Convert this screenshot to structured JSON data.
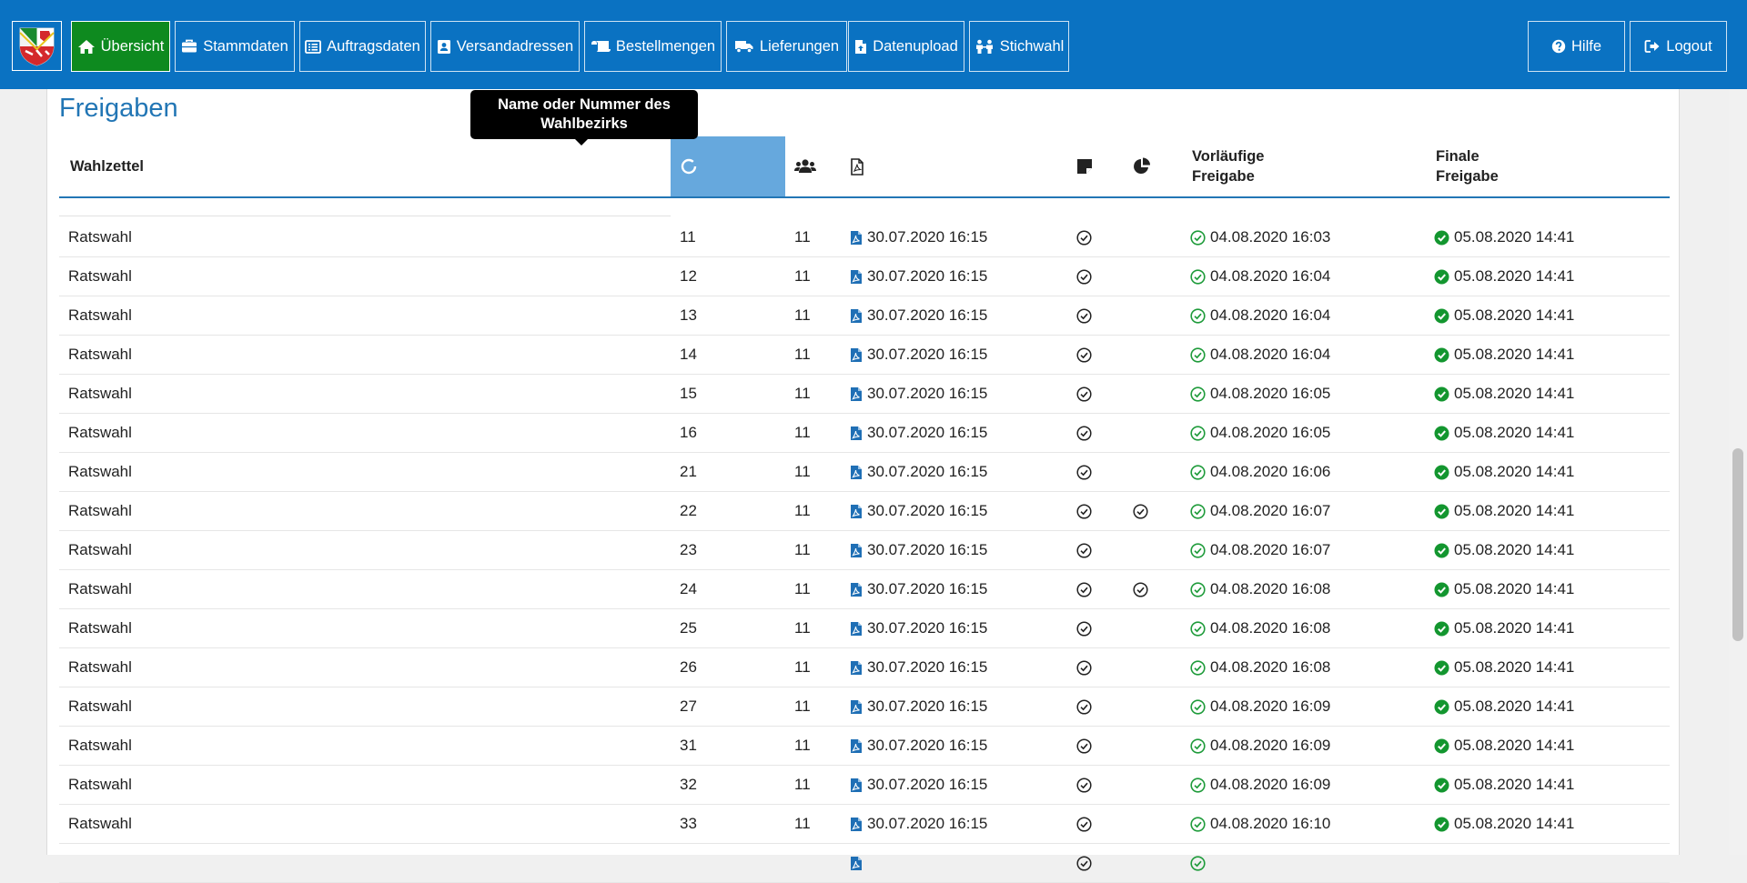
{
  "nav": {
    "items": [
      {
        "label": "Übersicht",
        "icon": "home-icon",
        "active": true
      },
      {
        "label": "Stammdaten",
        "icon": "briefcase-icon",
        "active": false
      },
      {
        "label": "Auftragsdaten",
        "icon": "list-icon",
        "active": false
      },
      {
        "label": "Versandadressen",
        "icon": "address-card-icon",
        "active": false
      },
      {
        "label": "Bestellmengen",
        "icon": "scroll-icon",
        "active": false
      },
      {
        "label": "Lieferungen",
        "icon": "truck-icon",
        "active": false
      },
      {
        "label": "Datenupload",
        "icon": "file-upload-icon",
        "active": false
      },
      {
        "label": "Stichwahl",
        "icon": "people-icon",
        "active": false
      }
    ],
    "right": [
      {
        "label": "Hilfe",
        "icon": "question-circle-icon"
      },
      {
        "label": "Logout",
        "icon": "sign-out-icon"
      }
    ]
  },
  "page": {
    "title": "Freigaben",
    "tooltip": "Name oder Nummer des Wahlbezirks"
  },
  "table": {
    "headers": {
      "wahlzettel": "Wahlzettel",
      "vorlaeufig_line1": "Vorläufige",
      "vorlaeufig_line2": "Freigabe",
      "final_line1": "Finale",
      "final_line2": "Freigabe"
    },
    "header_icons": [
      "circle-sort-icon",
      "users-icon",
      "file-pdf-icon",
      "sticky-note-icon",
      "pie-chart-icon"
    ],
    "rows": [
      {
        "wahlzettel": "Ratswahl",
        "nr": "11",
        "wz": "11",
        "pdf": "30.07.2020 16:15",
        "note": true,
        "chart": false,
        "vorlaeufig": "04.08.2020 16:03",
        "final": "05.08.2020 14:41"
      },
      {
        "wahlzettel": "Ratswahl",
        "nr": "12",
        "wz": "11",
        "pdf": "30.07.2020 16:15",
        "note": true,
        "chart": false,
        "vorlaeufig": "04.08.2020 16:04",
        "final": "05.08.2020 14:41"
      },
      {
        "wahlzettel": "Ratswahl",
        "nr": "13",
        "wz": "11",
        "pdf": "30.07.2020 16:15",
        "note": true,
        "chart": false,
        "vorlaeufig": "04.08.2020 16:04",
        "final": "05.08.2020 14:41"
      },
      {
        "wahlzettel": "Ratswahl",
        "nr": "14",
        "wz": "11",
        "pdf": "30.07.2020 16:15",
        "note": true,
        "chart": false,
        "vorlaeufig": "04.08.2020 16:04",
        "final": "05.08.2020 14:41"
      },
      {
        "wahlzettel": "Ratswahl",
        "nr": "15",
        "wz": "11",
        "pdf": "30.07.2020 16:15",
        "note": true,
        "chart": false,
        "vorlaeufig": "04.08.2020 16:05",
        "final": "05.08.2020 14:41"
      },
      {
        "wahlzettel": "Ratswahl",
        "nr": "16",
        "wz": "11",
        "pdf": "30.07.2020 16:15",
        "note": true,
        "chart": false,
        "vorlaeufig": "04.08.2020 16:05",
        "final": "05.08.2020 14:41"
      },
      {
        "wahlzettel": "Ratswahl",
        "nr": "21",
        "wz": "11",
        "pdf": "30.07.2020 16:15",
        "note": true,
        "chart": false,
        "vorlaeufig": "04.08.2020 16:06",
        "final": "05.08.2020 14:41"
      },
      {
        "wahlzettel": "Ratswahl",
        "nr": "22",
        "wz": "11",
        "pdf": "30.07.2020 16:15",
        "note": true,
        "chart": true,
        "vorlaeufig": "04.08.2020 16:07",
        "final": "05.08.2020 14:41"
      },
      {
        "wahlzettel": "Ratswahl",
        "nr": "23",
        "wz": "11",
        "pdf": "30.07.2020 16:15",
        "note": true,
        "chart": false,
        "vorlaeufig": "04.08.2020 16:07",
        "final": "05.08.2020 14:41"
      },
      {
        "wahlzettel": "Ratswahl",
        "nr": "24",
        "wz": "11",
        "pdf": "30.07.2020 16:15",
        "note": true,
        "chart": true,
        "vorlaeufig": "04.08.2020 16:08",
        "final": "05.08.2020 14:41"
      },
      {
        "wahlzettel": "Ratswahl",
        "nr": "25",
        "wz": "11",
        "pdf": "30.07.2020 16:15",
        "note": true,
        "chart": false,
        "vorlaeufig": "04.08.2020 16:08",
        "final": "05.08.2020 14:41"
      },
      {
        "wahlzettel": "Ratswahl",
        "nr": "26",
        "wz": "11",
        "pdf": "30.07.2020 16:15",
        "note": true,
        "chart": false,
        "vorlaeufig": "04.08.2020 16:08",
        "final": "05.08.2020 14:41"
      },
      {
        "wahlzettel": "Ratswahl",
        "nr": "27",
        "wz": "11",
        "pdf": "30.07.2020 16:15",
        "note": true,
        "chart": false,
        "vorlaeufig": "04.08.2020 16:09",
        "final": "05.08.2020 14:41"
      },
      {
        "wahlzettel": "Ratswahl",
        "nr": "31",
        "wz": "11",
        "pdf": "30.07.2020 16:15",
        "note": true,
        "chart": false,
        "vorlaeufig": "04.08.2020 16:09",
        "final": "05.08.2020 14:41"
      },
      {
        "wahlzettel": "Ratswahl",
        "nr": "32",
        "wz": "11",
        "pdf": "30.07.2020 16:15",
        "note": true,
        "chart": false,
        "vorlaeufig": "04.08.2020 16:09",
        "final": "05.08.2020 14:41"
      },
      {
        "wahlzettel": "Ratswahl",
        "nr": "33",
        "wz": "11",
        "pdf": "30.07.2020 16:15",
        "note": true,
        "chart": false,
        "vorlaeufig": "04.08.2020 16:10",
        "final": "05.08.2020 14:41"
      },
      {
        "wahlzettel": "",
        "nr": "",
        "wz": "",
        "pdf": "",
        "note": true,
        "chart": false,
        "vorlaeufig": "",
        "final": ""
      }
    ]
  },
  "colors": {
    "navbar": "#0a72c2",
    "active": "#0e8a1f",
    "accent": "#2276b5",
    "sorted_header": "#66a8dd",
    "pdf_icon": "#1f6fb5",
    "check_outline": "#1e9b3a",
    "check_filled": "#13962f"
  }
}
